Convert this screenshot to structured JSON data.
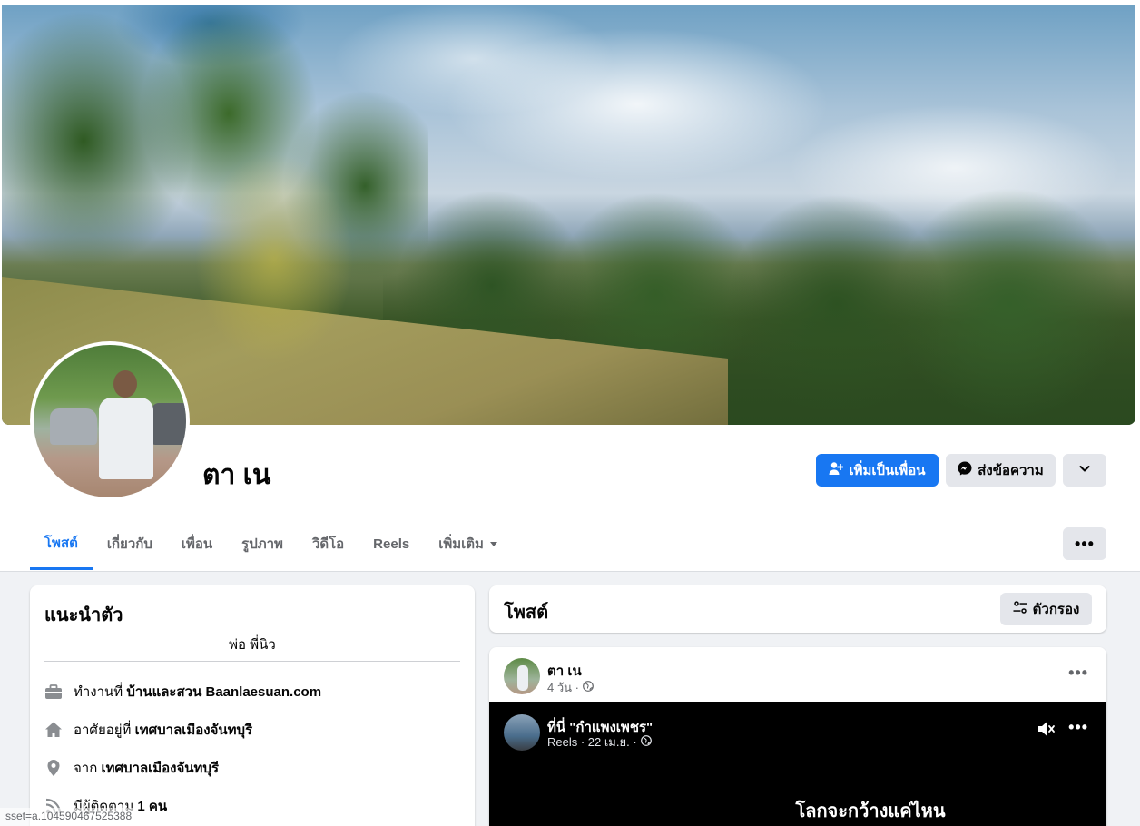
{
  "profile": {
    "name": "ตา เน",
    "add_friend_label": "เพิ่มเป็นเพื่อน",
    "message_label": "ส่งข้อความ"
  },
  "tabs": [
    {
      "label": "โพสต์",
      "active": true
    },
    {
      "label": "เกี่ยวกับ"
    },
    {
      "label": "เพื่อน"
    },
    {
      "label": "รูปภาพ"
    },
    {
      "label": "วิดีโอ"
    },
    {
      "label": "Reels"
    },
    {
      "label": "เพิ่มเติม"
    }
  ],
  "intro": {
    "title": "แนะนำตัว",
    "bio": "พ่อ พี่นิว",
    "items": [
      {
        "icon": "briefcase-icon",
        "prefix": "ทำงานที่",
        "value": "บ้านและสวน Baanlaesuan.com"
      },
      {
        "icon": "home-icon",
        "prefix": "อาศัยอยู่ที่",
        "value": "เทศบาลเมืองจันทบุรี"
      },
      {
        "icon": "location-pin-icon",
        "prefix": "จาก",
        "value": "เทศบาลเมืองจันทบุรี"
      },
      {
        "icon": "followers-icon",
        "prefix": "มีผู้ติดตาม",
        "value": "1 คน"
      }
    ]
  },
  "posts_header": {
    "title": "โพสต์",
    "filter_label": "ตัวกรอง"
  },
  "post": {
    "author": "ตา เน",
    "time": "4 วัน ·",
    "reel": {
      "title": "ที่นี่ \"กำแพงเพชร\"",
      "meta": "Reels · 22 เม.ย. ·",
      "caption": "โลกจะกว้างแค่ไหน"
    }
  },
  "status_bar": {
    "url": "sset=a.104590467525388"
  },
  "colors": {
    "accent": "#1877f2",
    "button_gray": "#e4e6eb",
    "text_secondary": "#65676b"
  }
}
